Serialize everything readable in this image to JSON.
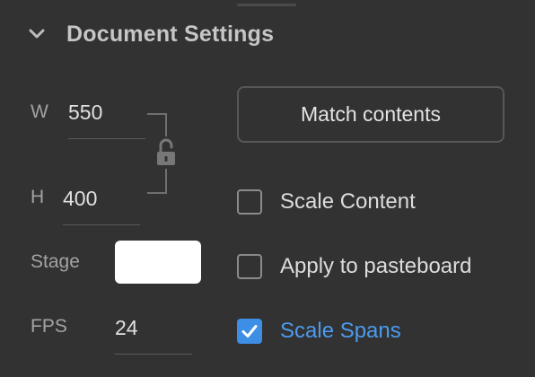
{
  "section": {
    "title": "Document Settings",
    "expanded": true
  },
  "width": {
    "label": "W",
    "value": "550"
  },
  "height": {
    "label": "H",
    "value": "400"
  },
  "stage": {
    "label": "Stage",
    "color": "#ffffff"
  },
  "fps": {
    "label": "FPS",
    "value": "24"
  },
  "match_button": {
    "label": "Match contents"
  },
  "options": [
    {
      "label": "Scale Content",
      "checked": false
    },
    {
      "label": "Apply to pasteboard",
      "checked": false
    },
    {
      "label": "Scale Spans",
      "checked": true
    }
  ],
  "colors": {
    "background": "#323232",
    "accent": "#3d8fe5",
    "accent_text": "#4b9bef"
  },
  "icons": {
    "section_toggle": "chevron-down-icon",
    "proportion_lock": "unlocked-padlock-icon",
    "checked": "checkmark-icon"
  }
}
